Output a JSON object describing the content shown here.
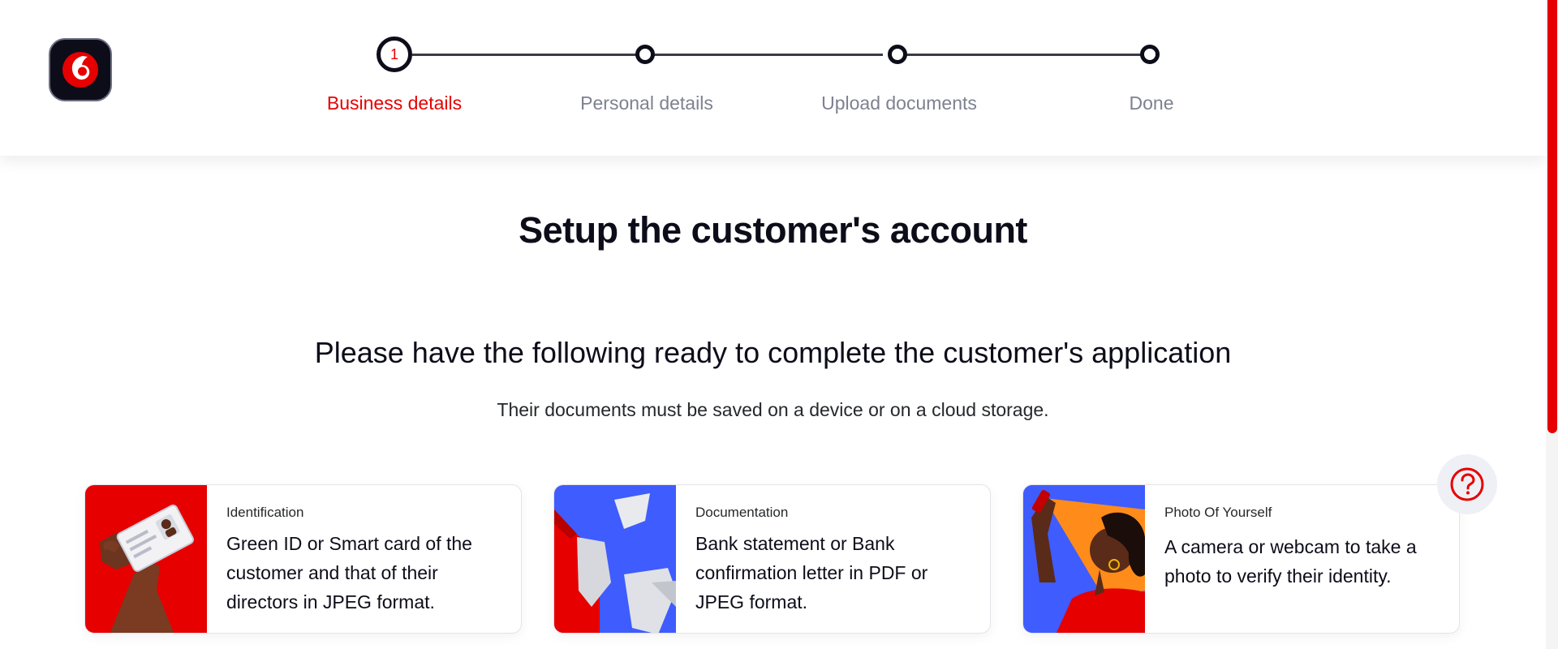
{
  "colors": {
    "brand_red": "#e60000",
    "dark": "#0d0d1a",
    "muted": "#7e8190"
  },
  "header": {
    "logo_icon": "vodafone-speechmark-icon",
    "steps": [
      {
        "number": "1",
        "label": "Business details",
        "state": "current"
      },
      {
        "label": "Personal details",
        "state": "upcoming"
      },
      {
        "label": "Upload documents",
        "state": "upcoming"
      },
      {
        "label": "Done",
        "state": "upcoming"
      }
    ]
  },
  "main": {
    "title": "Setup the customer's account",
    "subtitle": "Please have the following ready to complete the customer's application",
    "note": "Their documents must be saved on a device or on a cloud storage.",
    "cards": [
      {
        "title": "Identification",
        "text": "Green ID or Smart card of the customer and that of their directors in JPEG format.",
        "icon": "id-card-illustration"
      },
      {
        "title": "Documentation",
        "text": "Bank statement or Bank confirmation letter in PDF or JPEG format.",
        "icon": "documents-illustration"
      },
      {
        "title": "Photo Of Yourself",
        "text": "A camera or webcam to take a photo to verify their identity.",
        "icon": "selfie-illustration"
      }
    ]
  },
  "help": {
    "icon": "question-mark-icon"
  }
}
